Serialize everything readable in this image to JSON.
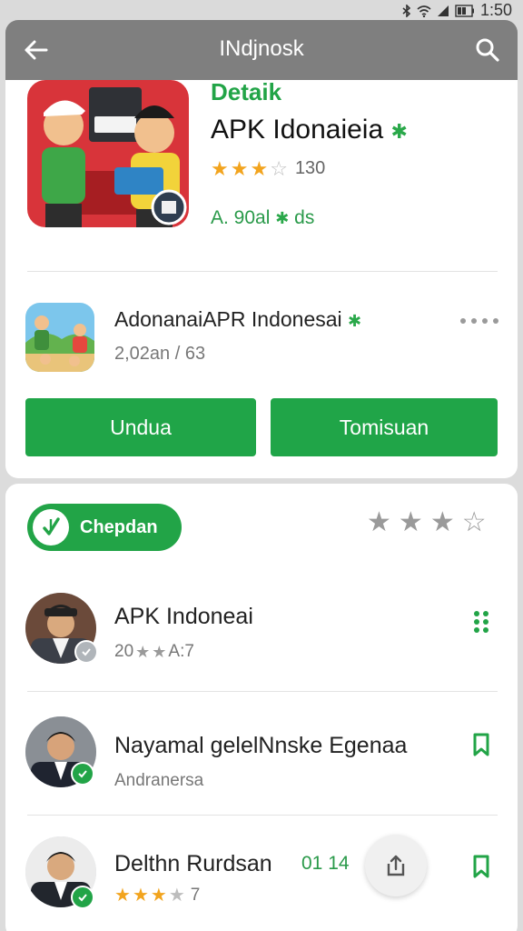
{
  "status_bar": {
    "time": "1:50"
  },
  "app_bar": {
    "title": "INdjnosk"
  },
  "hero": {
    "section_label": "Detaik",
    "title": "APK Idonaieia",
    "stars_filled": 3,
    "stars_total": 5,
    "rating_count": "130",
    "meta": "A. 90al",
    "meta_suffix": "ds"
  },
  "related_app": {
    "name": "AdonanaiAPR Indonesai",
    "stats": "2,02an / 63"
  },
  "buttons": {
    "download": "Undua",
    "other": "Tomisuan"
  },
  "reviews_header": {
    "badge_label": "Chepdan",
    "stars_filled": 3,
    "stars_total": 4
  },
  "reviews": [
    {
      "name": "APK Indoneai",
      "sub_prefix": "20",
      "sub_suffix": "A:7"
    },
    {
      "name": "Nayamal gelelNnske Egenaa",
      "sub": "Andranersa"
    },
    {
      "name": "Delthn Rurdsan",
      "time": "01 14",
      "rating": "7",
      "stars_filled": 3,
      "stars_total": 4
    }
  ],
  "colors": {
    "accent_green": "#20a548",
    "app_bar": "#7f7f7f",
    "star_gold": "#f2a41e"
  }
}
